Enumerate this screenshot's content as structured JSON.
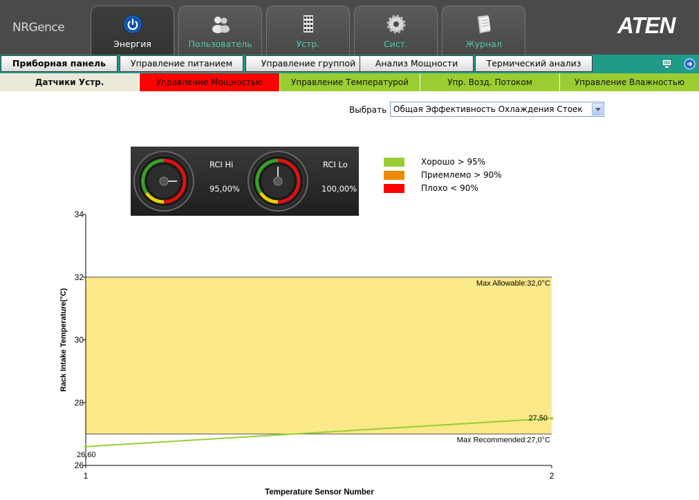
{
  "header": {
    "brand": "NRGence",
    "logo": "ATEN",
    "main_tabs": [
      {
        "label": "Энергия",
        "icon": "power-icon",
        "active": true
      },
      {
        "label": "Пользователь",
        "icon": "users-icon",
        "active": false
      },
      {
        "label": "Устр.",
        "icon": "device-icon",
        "active": false
      },
      {
        "label": "Сист.",
        "icon": "gear-icon",
        "active": false
      },
      {
        "label": "Журнал",
        "icon": "journal-icon",
        "active": false
      }
    ]
  },
  "subnav": {
    "tabs": [
      {
        "label": "Приборная панель",
        "active": true
      },
      {
        "label": "Управление питанием",
        "active": false
      },
      {
        "label": "Управление группой",
        "active": false
      },
      {
        "label": "Анализ Мощности",
        "active": false
      },
      {
        "label": "Термический анализ",
        "active": false
      }
    ],
    "utility_icons": [
      "monitor-icon",
      "logout-icon"
    ]
  },
  "thirdnav": {
    "tabs": [
      {
        "label": "Датчики Устр.",
        "bg": "#ece9d8"
      },
      {
        "label": "Управление Мощностью",
        "bg": "#ff0000"
      },
      {
        "label": "Управление Температурой",
        "bg": "#9acd32"
      },
      {
        "label": "Упр. Возд. Потоком",
        "bg": "#9acd32"
      },
      {
        "label": "Управление Влажностью",
        "bg": "#9acd32"
      }
    ]
  },
  "selector": {
    "label": "Выбрать",
    "value": "Общая Эффективность Охлаждения Стоек"
  },
  "gauges": [
    {
      "name": "RCI Hi",
      "value": "95,00%"
    },
    {
      "name": "RCI Lo",
      "value": "100,00%"
    }
  ],
  "legend": [
    {
      "label": "Хорошо > 95%",
      "color": "#9acd32"
    },
    {
      "label": "Приемлемо > 90%",
      "color": "#ee8a00"
    },
    {
      "label": "Плохо < 90%",
      "color": "#ff0000"
    }
  ],
  "chart_data": {
    "type": "line",
    "xlabel": "Temperature Sensor Number",
    "ylabel": "Rack Intake Temperature(°C)",
    "xlim": [
      1,
      2
    ],
    "ylim": [
      26,
      34
    ],
    "x_ticks": [
      "1",
      "2"
    ],
    "y_ticks": [
      "26",
      "28",
      "30",
      "32",
      "34"
    ],
    "band": {
      "from": 27,
      "to": 32,
      "color": "#fbe98a"
    },
    "max_allowable": {
      "value": 32,
      "label": "Max Allowable:32,0°C"
    },
    "max_recommended": {
      "value": 27,
      "label": "Max Recommended:27,0°C"
    },
    "series": [
      {
        "x": [
          1,
          2
        ],
        "y": [
          26.6,
          27.5
        ],
        "labels": [
          "26,60",
          "27,50"
        ],
        "color": "#9acd32"
      }
    ]
  }
}
